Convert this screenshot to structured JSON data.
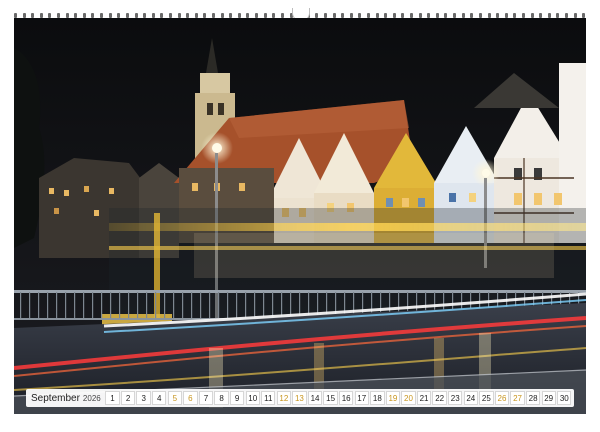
{
  "calendar": {
    "month": "September",
    "year": "2026",
    "days": [
      {
        "label": "1",
        "weekend": false
      },
      {
        "label": "2",
        "weekend": false
      },
      {
        "label": "3",
        "weekend": false
      },
      {
        "label": "4",
        "weekend": false
      },
      {
        "label": "5",
        "weekend": true
      },
      {
        "label": "6",
        "weekend": true
      },
      {
        "label": "7",
        "weekend": false
      },
      {
        "label": "8",
        "weekend": false
      },
      {
        "label": "9",
        "weekend": false
      },
      {
        "label": "10",
        "weekend": false
      },
      {
        "label": "11",
        "weekend": false
      },
      {
        "label": "12",
        "weekend": true
      },
      {
        "label": "13",
        "weekend": true
      },
      {
        "label": "14",
        "weekend": false
      },
      {
        "label": "15",
        "weekend": false
      },
      {
        "label": "16",
        "weekend": false
      },
      {
        "label": "17",
        "weekend": false
      },
      {
        "label": "18",
        "weekend": false
      },
      {
        "label": "19",
        "weekend": true
      },
      {
        "label": "20",
        "weekend": true
      },
      {
        "label": "21",
        "weekend": false
      },
      {
        "label": "22",
        "weekend": false
      },
      {
        "label": "23",
        "weekend": false
      },
      {
        "label": "24",
        "weekend": false
      },
      {
        "label": "25",
        "weekend": false
      },
      {
        "label": "26",
        "weekend": true
      },
      {
        "label": "27",
        "weekend": true
      },
      {
        "label": "28",
        "weekend": false
      },
      {
        "label": "29",
        "weekend": false
      },
      {
        "label": "30",
        "weekend": false
      }
    ],
    "weekend_color": "#c8951e"
  },
  "photo": {
    "sky_color": "#101214",
    "roof_color": "#a6512b",
    "light_trail_colors": [
      "#ffd34d",
      "#ffffff",
      "#ff3b3b",
      "#7fd3ff"
    ]
  }
}
